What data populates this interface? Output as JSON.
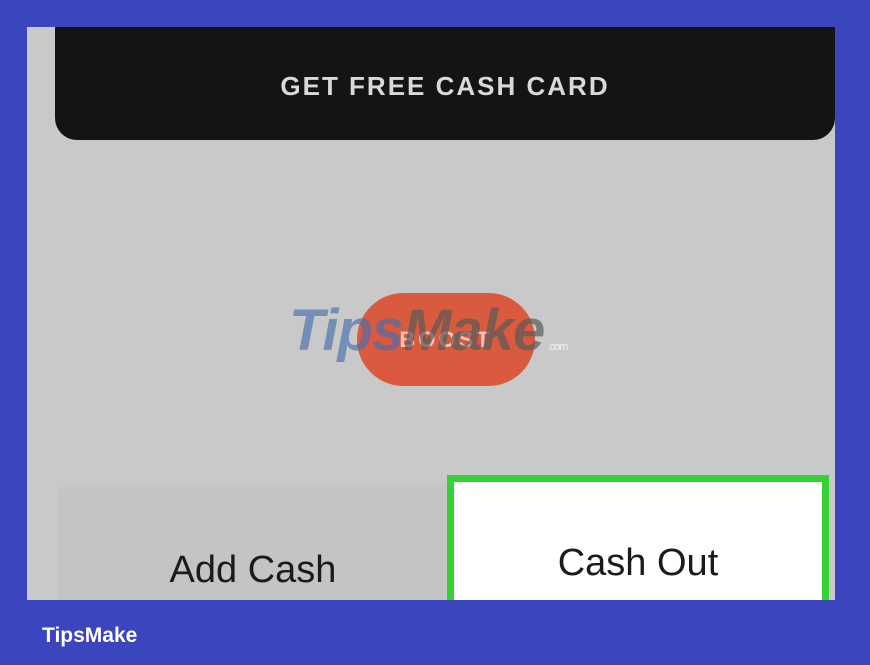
{
  "cash_card_button": {
    "label": "GET FREE CASH CARD"
  },
  "boost_button": {
    "label": "BOOST"
  },
  "watermark": {
    "tips": "Tips",
    "make": "Make",
    "domain": ".com"
  },
  "actions": {
    "add_cash_label": "Add Cash",
    "cash_out_label": "Cash Out"
  },
  "footer": {
    "brand": "TipsMake"
  },
  "colors": {
    "frame": "#3a45be",
    "screen_bg": "#c9c9c9",
    "highlight": "#35d135",
    "boost": "#d95a3f",
    "card_button": "#141414"
  }
}
